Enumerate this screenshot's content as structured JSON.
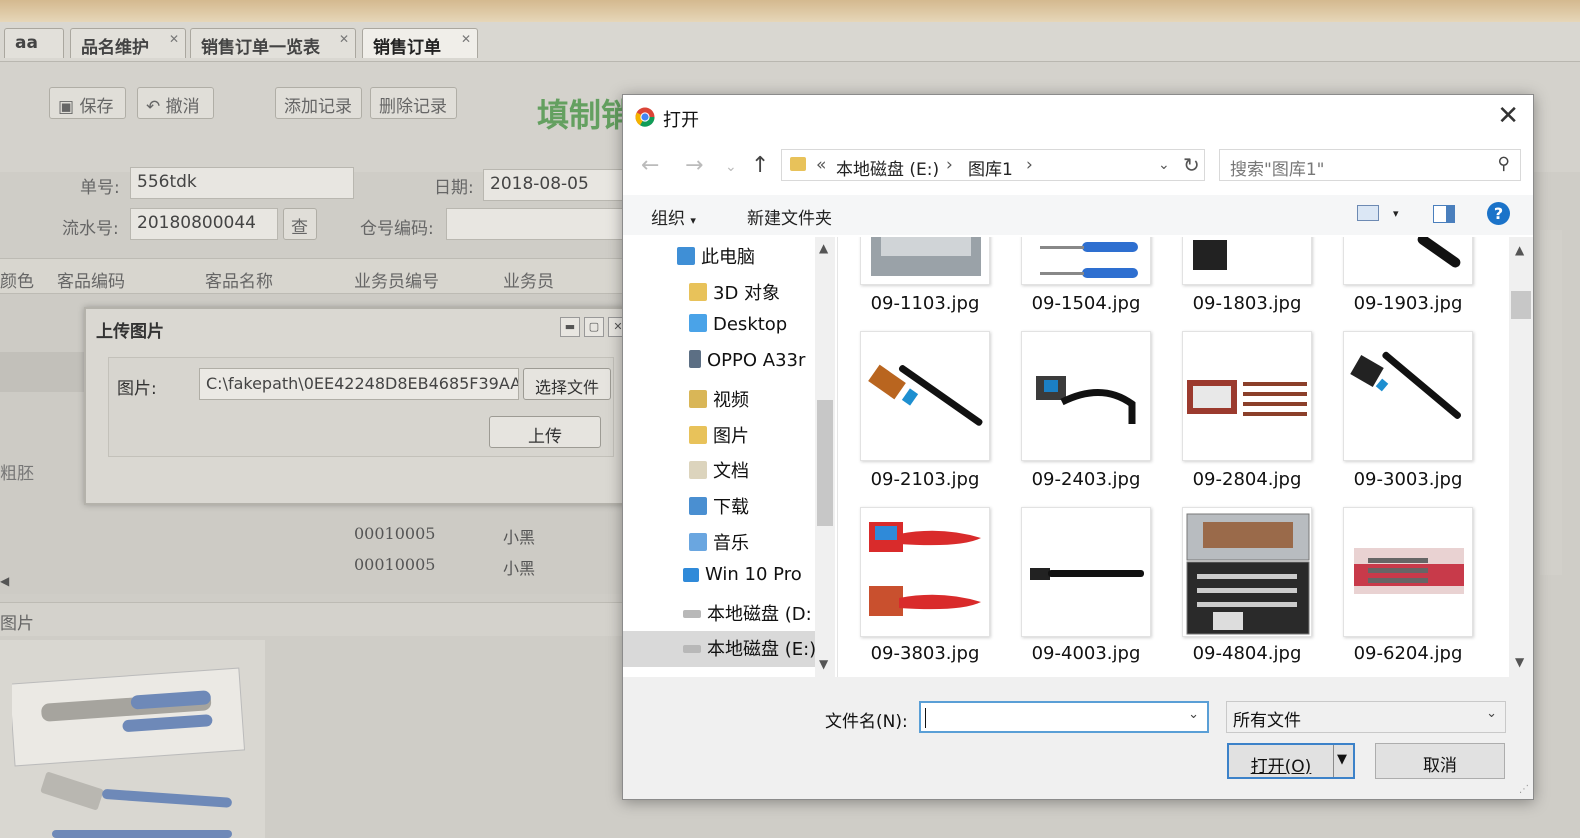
{
  "tabs": [
    {
      "label": "aa"
    },
    {
      "label": "品名维护"
    },
    {
      "label": "销售订单一览表"
    },
    {
      "label": "销售订单"
    }
  ],
  "toolbar": {
    "save": "保存",
    "undo": "撤消",
    "add_record": "添加记录",
    "delete_record": "删除记录",
    "form_title": "填制销"
  },
  "form": {
    "order_no_label": "单号:",
    "order_no_value": "556tdk",
    "date_label": "日期:",
    "date_value": "2018-08-05",
    "serial_label": "流水号:",
    "serial_value": "20180800044",
    "lookup_btn": "查",
    "warehouse_label": "仓号编码:"
  },
  "grid": {
    "columns": [
      "颜色",
      "客品编码",
      "客品名称",
      "业务员编号",
      "业务员"
    ],
    "row_fragment": "粗胚",
    "rows": [
      {
        "code": "00010005",
        "name": "小黑"
      },
      {
        "code": "00010005",
        "name": "小黑"
      }
    ],
    "image_section": "图片"
  },
  "upload_dialog": {
    "title": "上传图片",
    "image_label": "图片:",
    "path_value": "C:\\fakepath\\0EE42248D8EB4685F39AA",
    "choose_file": "选择文件",
    "upload": "上传"
  },
  "open_dialog": {
    "title": "打开",
    "address": {
      "prefix": "«",
      "drive": "本地磁盘 (E:)",
      "folder": "图库1"
    },
    "search_placeholder": "搜索\"图库1\"",
    "organize": "组织",
    "new_folder": "新建文件夹",
    "nav_items": [
      {
        "label": "此电脑",
        "icon": "computer-icon"
      },
      {
        "label": "3D 对象",
        "icon": "folder-3d-icon"
      },
      {
        "label": "Desktop",
        "icon": "desktop-folder-icon"
      },
      {
        "label": "OPPO A33r",
        "icon": "phone-icon"
      },
      {
        "label": "视频",
        "icon": "video-folder-icon"
      },
      {
        "label": "图片",
        "icon": "pictures-folder-icon"
      },
      {
        "label": "文档",
        "icon": "documents-folder-icon"
      },
      {
        "label": "下载",
        "icon": "downloads-folder-icon"
      },
      {
        "label": "音乐",
        "icon": "music-folder-icon"
      },
      {
        "label": "Win 10 Pro",
        "icon": "windows-drive-icon"
      },
      {
        "label": "本地磁盘 (D:",
        "icon": "drive-icon"
      },
      {
        "label": "本地磁盘 (E:)",
        "icon": "drive-icon"
      }
    ],
    "files": [
      {
        "name": "09-1103.jpg"
      },
      {
        "name": "09-1504.jpg"
      },
      {
        "name": "09-1803.jpg"
      },
      {
        "name": "09-1903.jpg"
      },
      {
        "name": "09-2103.jpg"
      },
      {
        "name": "09-2403.jpg"
      },
      {
        "name": "09-2804.jpg"
      },
      {
        "name": "09-3003.jpg"
      },
      {
        "name": "09-3803.jpg"
      },
      {
        "name": "09-4003.jpg"
      },
      {
        "name": "09-4804.jpg"
      },
      {
        "name": "09-6204.jpg"
      }
    ],
    "filename_label": "文件名(N):",
    "filename_value": "",
    "filetype": "所有文件",
    "open_btn": "打开(O)",
    "cancel_btn": "取消"
  },
  "colors": {
    "accent_blue": "#3c82c9",
    "title_green": "#64a060",
    "selection_gray": "#d9d9d9"
  }
}
